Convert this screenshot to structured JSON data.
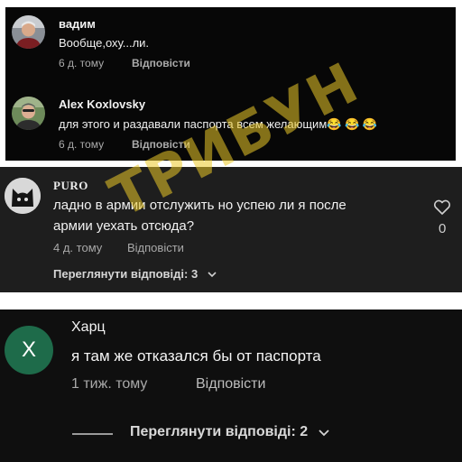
{
  "comments": [
    {
      "author": "вадим",
      "text": "Вообще,оху...ли.",
      "time": "6 д. тому",
      "reply_label": "Відповісти"
    },
    {
      "author": "Alex Koxlovsky",
      "text": "для этого и раздавали паспорта всем желающим😂 😂 😂",
      "time": "6 д. тому",
      "reply_label": "Відповісти"
    },
    {
      "author": "PURO",
      "text_line1": "ладно в армии отслужить но успею ли я после",
      "text_line2": "армии уехать отсюда?",
      "time": "4 д. тому",
      "reply_label": "Відповісти",
      "view_replies": "Переглянути відповіді: 3",
      "like_count": "0"
    },
    {
      "author": "Харц",
      "avatar_letter": "X",
      "text": "я там же отказался бы от паспорта",
      "time": "1 тиж. тому",
      "reply_label": "Відповісти",
      "view_replies": "Переглянути відповіді: 2"
    }
  ],
  "watermark": "ТРИБУН",
  "colors": {
    "avatar_green": "#1e6b4a",
    "watermark_yellow": "#ebc828"
  }
}
